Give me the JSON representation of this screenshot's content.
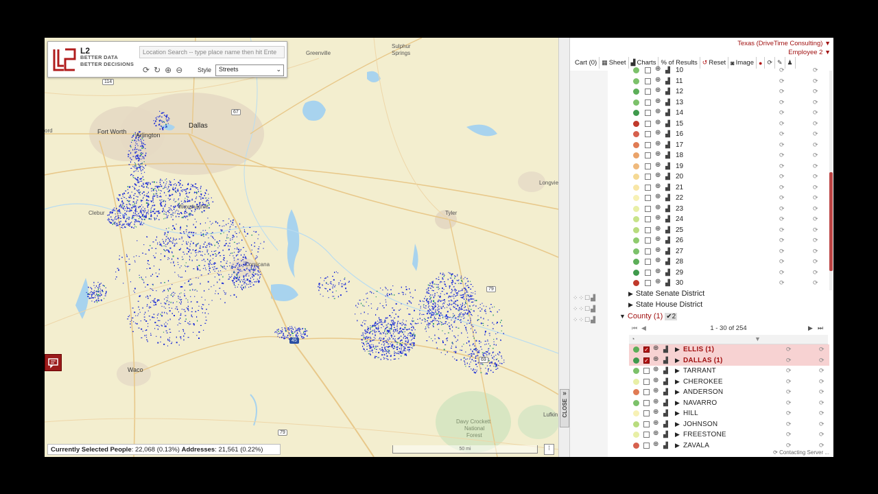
{
  "map": {
    "search_placeholder": "Location Search -- type place name then hit Ente",
    "brand": {
      "name": "L2",
      "tagline1": "BETTER DATA",
      "tagline2": "BETTER DECISIONS"
    },
    "style_label": "Style",
    "style_value": "Streets",
    "labels": {
      "dallas": "Dallas",
      "fort_worth": "Fort Worth",
      "arlington": "Arlington",
      "greenville": "Greenville",
      "sulphur_springs_1": "Sulphur",
      "sulphur_springs_2": "Springs",
      "longview": "Longvie",
      "tyler": "Tyler",
      "corsicana": "Corsicana",
      "waco": "Waco",
      "cleburne": "Clebur",
      "lufkin": "Lufkin",
      "davy1": "Davy Crockett",
      "davy2": "National",
      "davy3": "Forest",
      "ord": "ord",
      "waxahachie": "Waxahachie"
    },
    "shields": {
      "s114": "114",
      "s67": "67",
      "s79a": "79",
      "s79b": "79",
      "s69": "69",
      "s45": "45"
    },
    "status_people_label": "Currently Selected People",
    "status_people_value": ": 22,068 (0.13%)",
    "status_addr_label": "Addresses",
    "status_addr_value": ": 21,561 (0.22%)",
    "scale": "50 mi"
  },
  "panel": {
    "account": "Texas (DriveTime Consulting)",
    "user": "Employee 2",
    "toolbar": {
      "cart": "Cart (0)",
      "sheet": "Sheet",
      "charts": "Charts",
      "pct": "% of Results",
      "reset": "Reset",
      "image": "Image"
    },
    "districts": [
      {
        "num": "10",
        "color": "#7cc16a"
      },
      {
        "num": "11",
        "color": "#7cc16a"
      },
      {
        "num": "12",
        "color": "#5cae58"
      },
      {
        "num": "13",
        "color": "#7cc16a"
      },
      {
        "num": "14",
        "color": "#3f9a4c"
      },
      {
        "num": "15",
        "color": "#c0392b"
      },
      {
        "num": "16",
        "color": "#d6604d"
      },
      {
        "num": "17",
        "color": "#e07b54"
      },
      {
        "num": "18",
        "color": "#eaa36a"
      },
      {
        "num": "19",
        "color": "#efb97c"
      },
      {
        "num": "20",
        "color": "#f5d994"
      },
      {
        "num": "21",
        "color": "#f8e6a6"
      },
      {
        "num": "22",
        "color": "#f7f1b5"
      },
      {
        "num": "23",
        "color": "#e8efa6"
      },
      {
        "num": "24",
        "color": "#c7e389"
      },
      {
        "num": "25",
        "color": "#b8dc7e"
      },
      {
        "num": "26",
        "color": "#8fcb6e"
      },
      {
        "num": "27",
        "color": "#7cc16a"
      },
      {
        "num": "28",
        "color": "#5cae58"
      },
      {
        "num": "29",
        "color": "#3f9a4c"
      },
      {
        "num": "30",
        "color": "#c0392b"
      }
    ],
    "state_senate": "State Senate District",
    "state_house": "State House District",
    "county_label": "County (1)",
    "county_badge": "✔2",
    "pager": "1 - 30 of 254",
    "counties": [
      {
        "name": "ELLIS (1)",
        "color": "#5cae58",
        "selected": true
      },
      {
        "name": "DALLAS (1)",
        "color": "#3f9a4c",
        "selected": true
      },
      {
        "name": "TARRANT",
        "color": "#7cc16a",
        "selected": false
      },
      {
        "name": "CHEROKEE",
        "color": "#e8efa6",
        "selected": false
      },
      {
        "name": "ANDERSON",
        "color": "#e07b54",
        "selected": false
      },
      {
        "name": "NAVARRO",
        "color": "#7cc16a",
        "selected": false
      },
      {
        "name": "HILL",
        "color": "#f7f1b5",
        "selected": false
      },
      {
        "name": "JOHNSON",
        "color": "#b8dc7e",
        "selected": false
      },
      {
        "name": "FREESTONE",
        "color": "#e8efa6",
        "selected": false
      },
      {
        "name": "ZAVALA",
        "color": "#d6604d",
        "selected": false
      }
    ],
    "close": "CLOSE",
    "contacting": "Contacting Server ..."
  }
}
